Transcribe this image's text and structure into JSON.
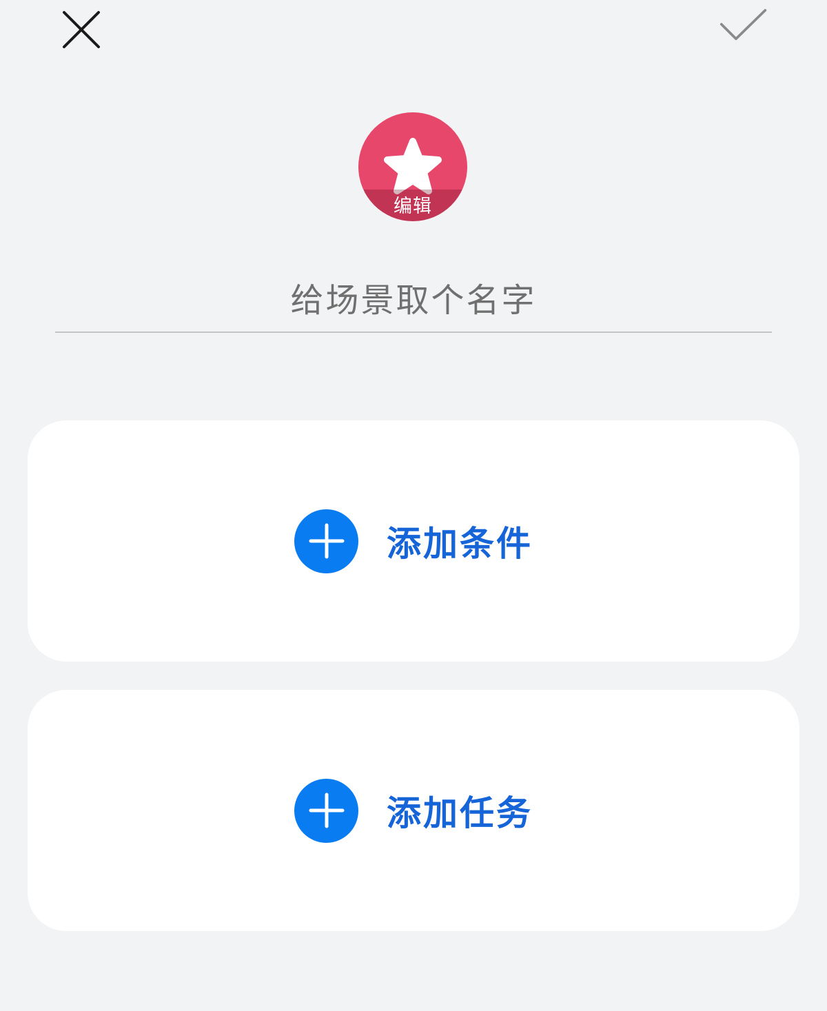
{
  "header": {
    "close_icon": "close-icon",
    "confirm_icon": "checkmark-icon"
  },
  "avatar": {
    "icon": "star-icon",
    "background_color": "#e6476a",
    "edit_label": "编辑"
  },
  "scene_name": {
    "placeholder": "给场景取个名字",
    "value": ""
  },
  "cards": {
    "conditions": {
      "icon": "plus-icon",
      "label": "添加条件"
    },
    "tasks": {
      "icon": "plus-icon",
      "label": "添加任务"
    }
  },
  "colors": {
    "accent": "#0a7cf2",
    "label_blue": "#1565d8",
    "background": "#f2f3f5"
  }
}
